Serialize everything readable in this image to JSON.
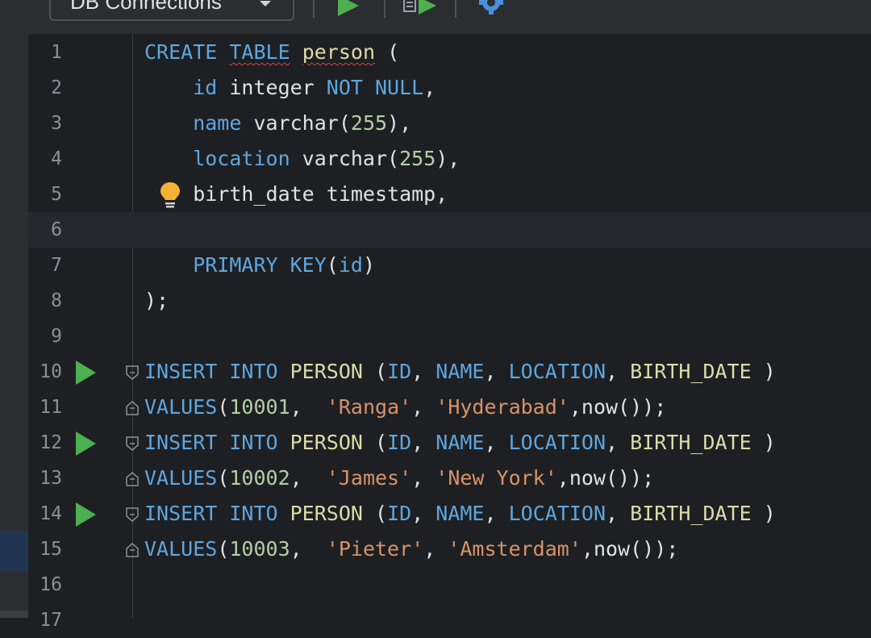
{
  "toolbar": {
    "db_connections_label": "DB Connections",
    "icons": [
      "chevron-down-icon",
      "run-icon",
      "run-selection-icon",
      "settings-gear-icon"
    ]
  },
  "colors": {
    "keyword": "#5ea6e0",
    "identifier": "#dcdcaa",
    "number": "#b5cea8",
    "string": "#d7936a",
    "text": "#dfe1e5",
    "run_green": "#4caf50",
    "bulb": "#f2b233"
  },
  "editor": {
    "line_numbers": [
      "1",
      "2",
      "3",
      "4",
      "5",
      "6",
      "7",
      "8",
      "9",
      "10",
      "11",
      "12",
      "13",
      "14",
      "15",
      "16",
      "17"
    ],
    "current_line": "6",
    "lines": [
      [
        {
          "t": "CREATE",
          "c": "kw"
        },
        {
          "t": " ",
          "c": "p"
        },
        {
          "t": "TABLE",
          "c": "kw sq"
        },
        {
          "t": " ",
          "c": "p"
        },
        {
          "t": "person",
          "c": "id sq"
        },
        {
          "t": " (",
          "c": "p"
        }
      ],
      [
        {
          "t": "    id",
          "c": "kw"
        },
        {
          "t": " integer ",
          "c": "fn"
        },
        {
          "t": "NOT NULL",
          "c": "kw"
        },
        {
          "t": ",",
          "c": "p"
        }
      ],
      [
        {
          "t": "    name",
          "c": "kw"
        },
        {
          "t": " varchar(",
          "c": "fn"
        },
        {
          "t": "255",
          "c": "num"
        },
        {
          "t": "),",
          "c": "p"
        }
      ],
      [
        {
          "t": "    location",
          "c": "kw"
        },
        {
          "t": " varchar(",
          "c": "fn"
        },
        {
          "t": "255",
          "c": "num"
        },
        {
          "t": "),",
          "c": "p"
        }
      ],
      [
        {
          "t": "    birth_date timestamp,",
          "c": "fn"
        }
      ],
      [
        {
          "t": "",
          "c": "p"
        }
      ],
      [
        {
          "t": "    PRIMARY KEY",
          "c": "kw"
        },
        {
          "t": "(",
          "c": "p"
        },
        {
          "t": "id",
          "c": "kw"
        },
        {
          "t": ")",
          "c": "p"
        }
      ],
      [
        {
          "t": ");",
          "c": "p"
        }
      ],
      [
        {
          "t": "",
          "c": "p"
        }
      ],
      [
        {
          "t": "INSERT INTO",
          "c": "kw"
        },
        {
          "t": " PERSON ",
          "c": "id"
        },
        {
          "t": "(",
          "c": "p"
        },
        {
          "t": "ID",
          "c": "kw"
        },
        {
          "t": ", ",
          "c": "p"
        },
        {
          "t": "NAME",
          "c": "kw"
        },
        {
          "t": ", ",
          "c": "p"
        },
        {
          "t": "LOCATION",
          "c": "kw"
        },
        {
          "t": ", ",
          "c": "p"
        },
        {
          "t": "BIRTH_DATE",
          "c": "id"
        },
        {
          "t": " )",
          "c": "p"
        }
      ],
      [
        {
          "t": "VALUES",
          "c": "kw"
        },
        {
          "t": "(",
          "c": "p"
        },
        {
          "t": "10001",
          "c": "num"
        },
        {
          "t": ",  ",
          "c": "p"
        },
        {
          "t": "'Ranga'",
          "c": "str"
        },
        {
          "t": ", ",
          "c": "p"
        },
        {
          "t": "'Hyderabad'",
          "c": "str"
        },
        {
          "t": ",now());",
          "c": "p"
        }
      ],
      [
        {
          "t": "INSERT INTO",
          "c": "kw"
        },
        {
          "t": " PERSON ",
          "c": "id"
        },
        {
          "t": "(",
          "c": "p"
        },
        {
          "t": "ID",
          "c": "kw"
        },
        {
          "t": ", ",
          "c": "p"
        },
        {
          "t": "NAME",
          "c": "kw"
        },
        {
          "t": ", ",
          "c": "p"
        },
        {
          "t": "LOCATION",
          "c": "kw"
        },
        {
          "t": ", ",
          "c": "p"
        },
        {
          "t": "BIRTH_DATE",
          "c": "id"
        },
        {
          "t": " )",
          "c": "p"
        }
      ],
      [
        {
          "t": "VALUES",
          "c": "kw"
        },
        {
          "t": "(",
          "c": "p"
        },
        {
          "t": "10002",
          "c": "num"
        },
        {
          "t": ",  ",
          "c": "p"
        },
        {
          "t": "'James'",
          "c": "str"
        },
        {
          "t": ", ",
          "c": "p"
        },
        {
          "t": "'New York'",
          "c": "str"
        },
        {
          "t": ",now());",
          "c": "p"
        }
      ],
      [
        {
          "t": "INSERT INTO",
          "c": "kw"
        },
        {
          "t": " PERSON ",
          "c": "id"
        },
        {
          "t": "(",
          "c": "p"
        },
        {
          "t": "ID",
          "c": "kw"
        },
        {
          "t": ", ",
          "c": "p"
        },
        {
          "t": "NAME",
          "c": "kw"
        },
        {
          "t": ", ",
          "c": "p"
        },
        {
          "t": "LOCATION",
          "c": "kw"
        },
        {
          "t": ", ",
          "c": "p"
        },
        {
          "t": "BIRTH_DATE",
          "c": "id"
        },
        {
          "t": " )",
          "c": "p"
        }
      ],
      [
        {
          "t": "VALUES",
          "c": "kw"
        },
        {
          "t": "(",
          "c": "p"
        },
        {
          "t": "10003",
          "c": "num"
        },
        {
          "t": ",  ",
          "c": "p"
        },
        {
          "t": "'Pieter'",
          "c": "str"
        },
        {
          "t": ", ",
          "c": "p"
        },
        {
          "t": "'Amsterdam'",
          "c": "str"
        },
        {
          "t": ",now());",
          "c": "p"
        }
      ],
      [
        {
          "t": "",
          "c": "p"
        }
      ],
      [
        {
          "t": "",
          "c": "p"
        }
      ]
    ],
    "run_gutter_lines": [
      "10",
      "12",
      "14"
    ],
    "fold_gutter_lines": [
      "10",
      "11",
      "12",
      "13",
      "14",
      "15"
    ],
    "intention_bulb_line": "5"
  }
}
